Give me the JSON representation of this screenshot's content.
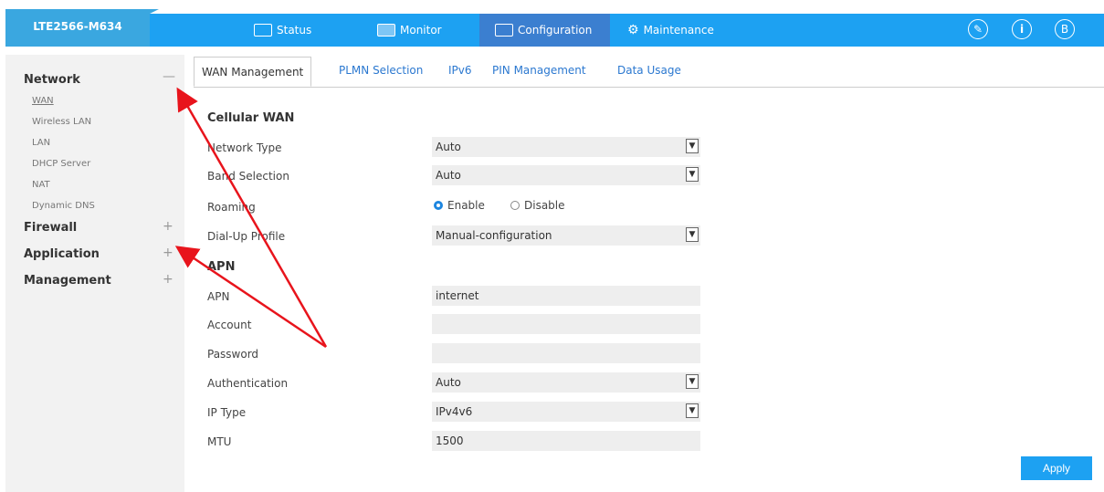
{
  "header": {
    "brand": "LTE2566-M634",
    "nav": [
      {
        "label": "Status",
        "icon": "status-icon"
      },
      {
        "label": "Monitor",
        "icon": "monitor-icon"
      },
      {
        "label": "Configuration",
        "icon": "configuration-icon",
        "active": true
      },
      {
        "label": "Maintenance",
        "icon": "maintenance-gear-icon"
      }
    ],
    "right_icons": [
      "wizard-icon",
      "info-icon",
      "logout-icon"
    ],
    "accent": "#1da1f2"
  },
  "sidebar": {
    "groups": [
      {
        "label": "Network",
        "sign": "—",
        "items": [
          "WAN",
          "Wireless LAN",
          "LAN",
          "DHCP Server",
          "NAT",
          "Dynamic DNS"
        ]
      },
      {
        "label": "Firewall",
        "sign": "+"
      },
      {
        "label": "Application",
        "sign": "+"
      },
      {
        "label": "Management",
        "sign": "+"
      }
    ],
    "active_item": "WAN"
  },
  "tabs": [
    "WAN Management",
    "PLMN Selection",
    "IPv6",
    "PIN Management",
    "Data Usage"
  ],
  "form": {
    "cellular_title": "Cellular WAN",
    "network_type": {
      "label": "Network Type",
      "value": "Auto"
    },
    "band_selection": {
      "label": "Band Selection",
      "value": "Auto"
    },
    "roaming": {
      "label": "Roaming",
      "enable": "Enable",
      "disable": "Disable",
      "selected": "Enable"
    },
    "dialup_profile": {
      "label": "Dial-Up Profile",
      "value": "Manual-configuration"
    },
    "apn_title": "APN",
    "apn": {
      "label": "APN",
      "value": "internet"
    },
    "account": {
      "label": "Account",
      "value": ""
    },
    "password": {
      "label": "Password",
      "value": ""
    },
    "authentication": {
      "label": "Authentication",
      "value": "Auto"
    },
    "ip_type": {
      "label": "IP Type",
      "value": "IPv4v6"
    },
    "mtu": {
      "label": "MTU",
      "value": "1500"
    },
    "apply": "Apply"
  },
  "annotation_color": "#e8141c"
}
